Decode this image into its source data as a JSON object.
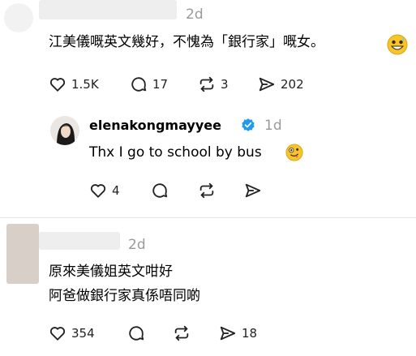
{
  "comment1": {
    "time": "2d",
    "text": "江美儀嘅英文幾好，不愧為「銀行家」嘅女。",
    "emoji_icon": "grinning-sweat-emoji-icon",
    "likes": "1.5K",
    "replies": "17",
    "reposts": "3",
    "shares": "202"
  },
  "reply": {
    "username": "elenakongmayyee",
    "verified_icon": "verified-badge-icon",
    "time": "1d",
    "text": "Thx I go to school by bus",
    "emoji_icon": "zany-face-emoji-icon",
    "likes": "4"
  },
  "comment2": {
    "time": "2d",
    "lines": [
      "原來美儀姐英文咁好",
      "阿爸做銀行家真係唔同啲"
    ],
    "likes": "354",
    "shares": "18"
  },
  "colors": {
    "verified": "#1d9bf0",
    "divider": "#e6e6e6",
    "muted": "#9a9a9a"
  }
}
